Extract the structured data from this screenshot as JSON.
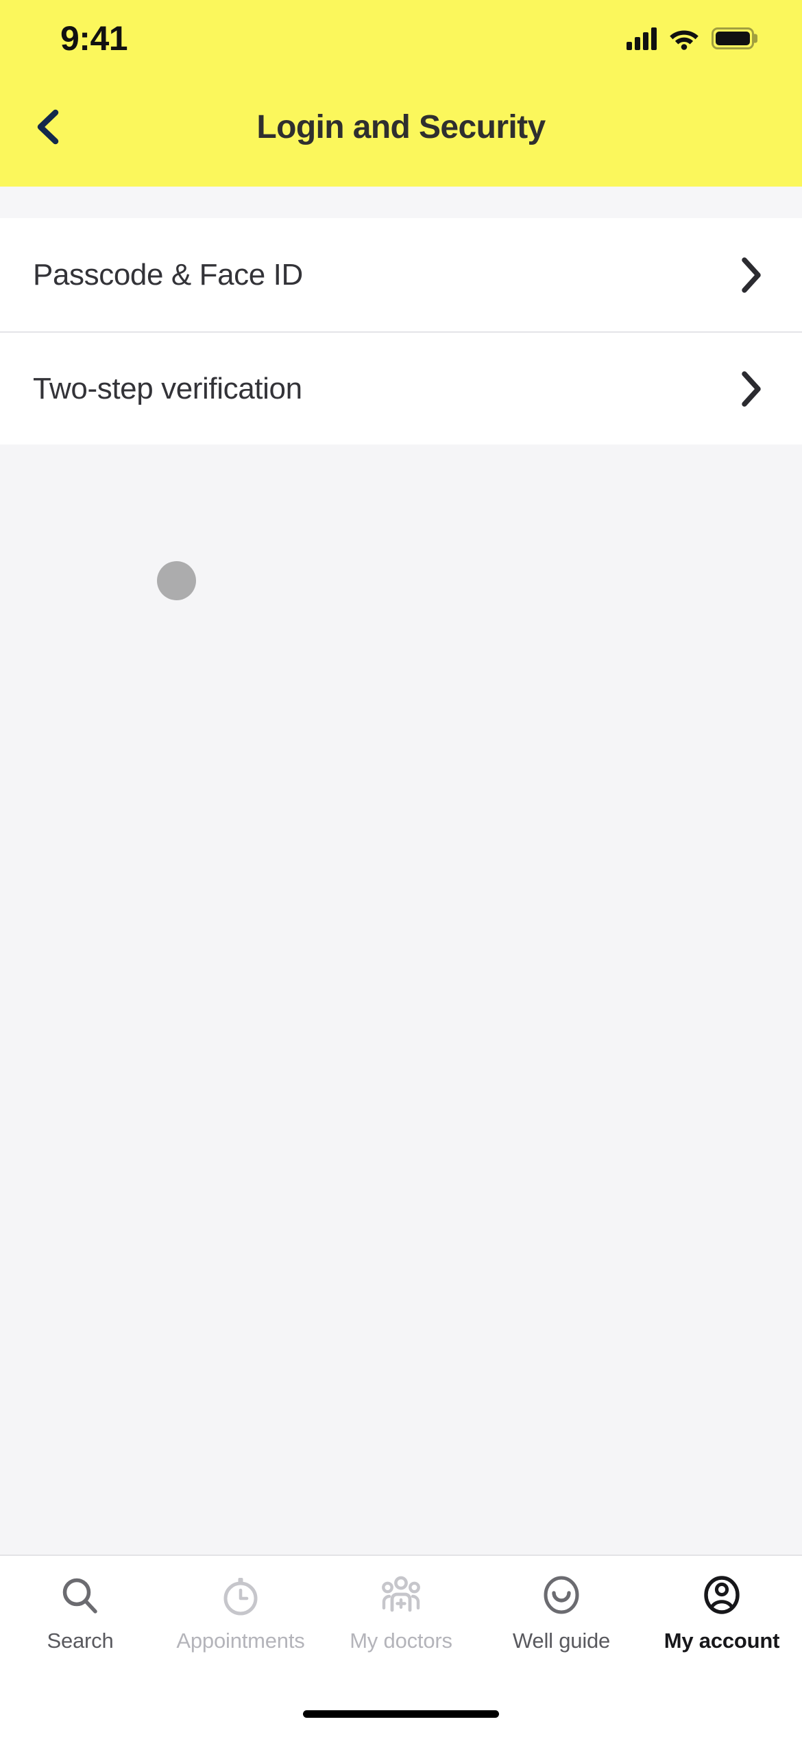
{
  "status_bar": {
    "time": "9:41",
    "signal_icon": "cellular-signal-icon",
    "wifi_icon": "wifi-icon",
    "battery_icon": "battery-full-icon"
  },
  "header": {
    "title": "Login and Security",
    "back_icon": "chevron-left-icon",
    "background_color": "#FBF75C",
    "title_color": "#2F2F2F",
    "back_icon_color": "#13294B"
  },
  "list": {
    "rows": [
      {
        "label": "Passcode & Face ID",
        "chevron_icon": "chevron-right-icon"
      },
      {
        "label": "Two-step verification",
        "chevron_icon": "chevron-right-icon"
      }
    ]
  },
  "touch_indicator": {
    "name": "touch-point-indicator",
    "color": "#5A5A5A"
  },
  "tabbar": {
    "tabs": [
      {
        "label": "Search",
        "icon": "search-icon",
        "state": "state-default",
        "color": "#59595E"
      },
      {
        "label": "Appointments",
        "icon": "stopwatch-icon",
        "state": "state-dim",
        "color": "#B4B4BA"
      },
      {
        "label": "My doctors",
        "icon": "doctors-group-icon",
        "state": "state-dim",
        "color": "#B4B4BA"
      },
      {
        "label": "Well guide",
        "icon": "smiley-face-icon",
        "state": "state-default",
        "color": "#59595E"
      },
      {
        "label": "My account",
        "icon": "account-avatar-icon",
        "state": "state-active",
        "color": "#17171A"
      }
    ]
  },
  "home_indicator": {
    "name": "home-indicator",
    "color": "#000000"
  }
}
